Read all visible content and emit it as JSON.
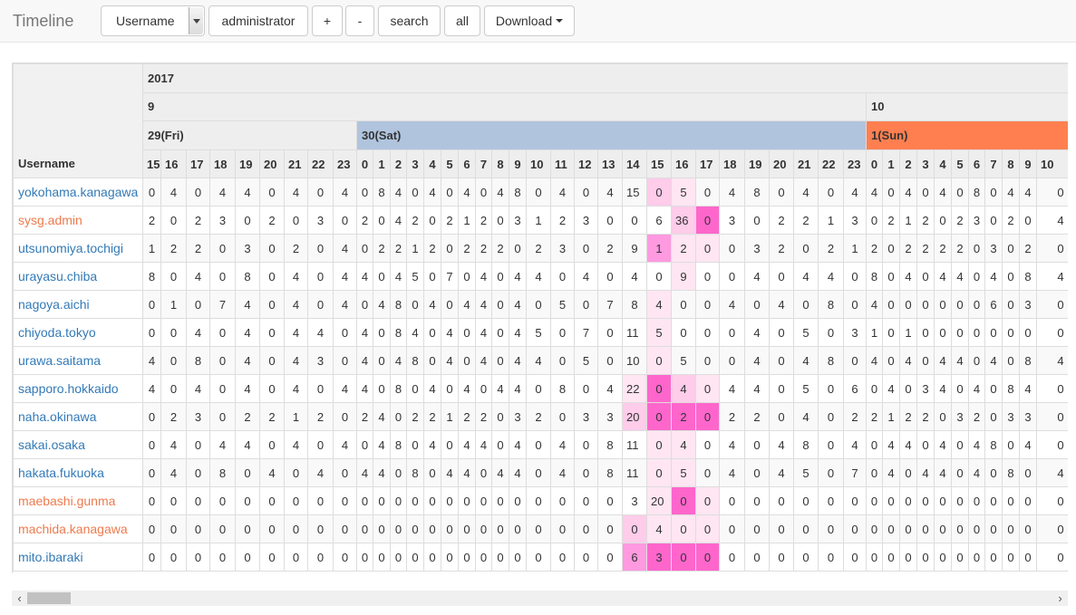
{
  "navbar": {
    "brand": "Timeline",
    "select_value": "Username",
    "query_value": "administrator",
    "plus_label": "+",
    "minus_label": "-",
    "search_label": "search",
    "all_label": "all",
    "download_label": "Download"
  },
  "table": {
    "year_label": "2017",
    "username_header": "Username",
    "months": [
      {
        "label": "9",
        "span": 33
      },
      {
        "label": "10",
        "span": 11
      }
    ],
    "days": [
      {
        "label": "29(Fri)",
        "span": 9,
        "style": "plain"
      },
      {
        "label": "30(Sat)",
        "span": 24,
        "style": "sat"
      },
      {
        "label": "1(Sun)",
        "span": 11,
        "style": "sun"
      }
    ],
    "hours": [
      15,
      16,
      17,
      18,
      19,
      20,
      21,
      22,
      23,
      0,
      1,
      2,
      3,
      4,
      5,
      6,
      7,
      8,
      9,
      10,
      11,
      12,
      13,
      14,
      15,
      16,
      17,
      18,
      19,
      20,
      21,
      22,
      23,
      0,
      1,
      2,
      3,
      4,
      5,
      6,
      7,
      8,
      9,
      10
    ],
    "rows": [
      {
        "name": "yokohama.kanagawa",
        "color": "blue",
        "values": [
          0,
          4,
          0,
          4,
          4,
          0,
          4,
          0,
          4,
          0,
          8,
          4,
          0,
          4,
          0,
          4,
          0,
          4,
          8,
          0,
          4,
          0,
          4,
          15,
          0,
          5,
          0,
          4,
          8,
          0,
          4,
          0,
          4,
          4,
          0,
          4,
          0,
          4,
          0,
          8,
          0,
          4,
          4,
          0
        ]
      },
      {
        "name": "sysg.admin",
        "color": "orange",
        "values": [
          2,
          0,
          2,
          3,
          0,
          2,
          0,
          3,
          0,
          2,
          0,
          4,
          2,
          0,
          2,
          1,
          2,
          0,
          3,
          1,
          2,
          3,
          0,
          0,
          6,
          36,
          0,
          3,
          0,
          2,
          2,
          1,
          3,
          0,
          2,
          1,
          2,
          0,
          2,
          3,
          0,
          2,
          0,
          4
        ]
      },
      {
        "name": "utsunomiya.tochigi",
        "color": "blue",
        "values": [
          1,
          2,
          2,
          0,
          3,
          0,
          2,
          0,
          4,
          0,
          2,
          2,
          1,
          2,
          0,
          2,
          2,
          2,
          0,
          2,
          3,
          0,
          2,
          9,
          1,
          2,
          0,
          0,
          3,
          2,
          0,
          2,
          1,
          2,
          0,
          2,
          2,
          2,
          2,
          0,
          3,
          0,
          2,
          0
        ]
      },
      {
        "name": "urayasu.chiba",
        "color": "blue",
        "values": [
          8,
          0,
          4,
          0,
          8,
          0,
          4,
          0,
          4,
          4,
          0,
          4,
          5,
          0,
          7,
          0,
          4,
          0,
          4,
          4,
          0,
          4,
          0,
          4,
          0,
          9,
          0,
          0,
          4,
          0,
          4,
          4,
          0,
          8,
          0,
          4,
          0,
          4,
          4,
          0,
          4,
          0,
          8,
          4
        ]
      },
      {
        "name": "nagoya.aichi",
        "color": "blue",
        "values": [
          0,
          1,
          0,
          7,
          4,
          0,
          4,
          0,
          4,
          0,
          4,
          8,
          0,
          4,
          0,
          4,
          4,
          0,
          4,
          0,
          5,
          0,
          7,
          8,
          4,
          0,
          0,
          4,
          0,
          4,
          0,
          8,
          0,
          4,
          0,
          0,
          0,
          0,
          0,
          0,
          6,
          0,
          3,
          0
        ]
      },
      {
        "name": "chiyoda.tokyo",
        "color": "blue",
        "values": [
          0,
          0,
          4,
          0,
          4,
          0,
          4,
          4,
          0,
          4,
          0,
          8,
          4,
          0,
          4,
          0,
          4,
          0,
          4,
          5,
          0,
          7,
          0,
          11,
          5,
          0,
          0,
          0,
          4,
          0,
          5,
          0,
          3,
          1,
          0,
          1,
          0,
          0,
          0,
          0,
          0,
          0,
          0,
          0
        ]
      },
      {
        "name": "urawa.saitama",
        "color": "blue",
        "values": [
          4,
          0,
          8,
          0,
          4,
          0,
          4,
          3,
          0,
          4,
          0,
          4,
          8,
          0,
          4,
          0,
          4,
          0,
          4,
          4,
          0,
          5,
          0,
          10,
          0,
          5,
          0,
          0,
          4,
          0,
          4,
          8,
          0,
          4,
          0,
          4,
          0,
          4,
          4,
          0,
          4,
          0,
          8,
          4
        ]
      },
      {
        "name": "sapporo.hokkaido",
        "color": "blue",
        "values": [
          4,
          0,
          4,
          0,
          4,
          0,
          4,
          0,
          4,
          4,
          0,
          8,
          0,
          4,
          0,
          4,
          0,
          4,
          4,
          0,
          8,
          0,
          4,
          22,
          0,
          4,
          0,
          4,
          4,
          0,
          5,
          0,
          6,
          0,
          4,
          0,
          3,
          4,
          0,
          4,
          0,
          8,
          4,
          0
        ]
      },
      {
        "name": "naha.okinawa",
        "color": "blue",
        "values": [
          0,
          2,
          3,
          0,
          2,
          2,
          1,
          2,
          0,
          2,
          4,
          0,
          2,
          2,
          1,
          2,
          2,
          0,
          3,
          2,
          0,
          3,
          3,
          20,
          0,
          2,
          0,
          2,
          2,
          0,
          4,
          0,
          2,
          2,
          1,
          2,
          2,
          0,
          3,
          2,
          0,
          3,
          3,
          0
        ]
      },
      {
        "name": "sakai.osaka",
        "color": "blue",
        "values": [
          0,
          4,
          0,
          4,
          4,
          0,
          4,
          0,
          4,
          0,
          4,
          8,
          0,
          4,
          0,
          4,
          4,
          0,
          4,
          0,
          4,
          0,
          8,
          11,
          0,
          4,
          0,
          4,
          0,
          4,
          8,
          0,
          4,
          0,
          4,
          4,
          0,
          4,
          0,
          4,
          8,
          0,
          4,
          0
        ]
      },
      {
        "name": "hakata.fukuoka",
        "color": "blue",
        "values": [
          0,
          4,
          0,
          8,
          0,
          4,
          0,
          4,
          0,
          4,
          4,
          0,
          8,
          0,
          4,
          4,
          0,
          4,
          4,
          0,
          4,
          0,
          8,
          11,
          0,
          5,
          0,
          4,
          0,
          4,
          5,
          0,
          7,
          0,
          4,
          0,
          4,
          4,
          0,
          4,
          0,
          8,
          0,
          4
        ]
      },
      {
        "name": "maebashi.gunma",
        "color": "orange",
        "values": [
          0,
          0,
          0,
          0,
          0,
          0,
          0,
          0,
          0,
          0,
          0,
          0,
          0,
          0,
          0,
          0,
          0,
          0,
          0,
          0,
          0,
          0,
          0,
          3,
          20,
          0,
          0,
          0,
          0,
          0,
          0,
          0,
          0,
          0,
          0,
          0,
          0,
          0,
          0,
          0,
          0,
          0,
          0,
          0
        ]
      },
      {
        "name": "machida.kanagawa",
        "color": "orange",
        "values": [
          0,
          0,
          0,
          0,
          0,
          0,
          0,
          0,
          0,
          0,
          0,
          0,
          0,
          0,
          0,
          0,
          0,
          0,
          0,
          0,
          0,
          0,
          0,
          0,
          4,
          0,
          0,
          0,
          0,
          0,
          0,
          0,
          0,
          0,
          0,
          0,
          0,
          0,
          0,
          0,
          0,
          0,
          0,
          0
        ]
      },
      {
        "name": "mito.ibaraki",
        "color": "blue",
        "values": [
          0,
          0,
          0,
          0,
          0,
          0,
          0,
          0,
          0,
          0,
          0,
          0,
          0,
          0,
          0,
          0,
          0,
          0,
          0,
          0,
          0,
          0,
          0,
          6,
          3,
          0,
          0,
          0,
          0,
          0,
          0,
          0,
          0,
          0,
          0,
          0,
          0,
          0,
          0,
          0,
          0,
          0,
          0,
          0
        ]
      }
    ],
    "highlights": [
      {
        "row": 0,
        "col": 24,
        "level": 2
      },
      {
        "row": 0,
        "col": 25,
        "level": 1
      },
      {
        "row": 1,
        "col": 25,
        "level": 2
      },
      {
        "row": 1,
        "col": 26,
        "level": 4
      },
      {
        "row": 2,
        "col": 24,
        "level": 3
      },
      {
        "row": 2,
        "col": 25,
        "level": 1
      },
      {
        "row": 2,
        "col": 26,
        "level": 1
      },
      {
        "row": 3,
        "col": 25,
        "level": 1
      },
      {
        "row": 4,
        "col": 24,
        "level": 1
      },
      {
        "row": 5,
        "col": 24,
        "level": 1
      },
      {
        "row": 6,
        "col": 24,
        "level": 1
      },
      {
        "row": 7,
        "col": 23,
        "level": 1
      },
      {
        "row": 7,
        "col": 24,
        "level": 4
      },
      {
        "row": 7,
        "col": 25,
        "level": 2
      },
      {
        "row": 7,
        "col": 26,
        "level": 1
      },
      {
        "row": 8,
        "col": 23,
        "level": 2
      },
      {
        "row": 8,
        "col": 24,
        "level": 4
      },
      {
        "row": 8,
        "col": 25,
        "level": 4
      },
      {
        "row": 8,
        "col": 26,
        "level": 4
      },
      {
        "row": 9,
        "col": 24,
        "level": 1
      },
      {
        "row": 9,
        "col": 25,
        "level": 1
      },
      {
        "row": 10,
        "col": 24,
        "level": 1
      },
      {
        "row": 10,
        "col": 25,
        "level": 1
      },
      {
        "row": 11,
        "col": 24,
        "level": 1
      },
      {
        "row": 11,
        "col": 25,
        "level": 4
      },
      {
        "row": 11,
        "col": 26,
        "level": 1
      },
      {
        "row": 12,
        "col": 23,
        "level": 2
      },
      {
        "row": 12,
        "col": 24,
        "level": 1
      },
      {
        "row": 12,
        "col": 25,
        "level": 1
      },
      {
        "row": 12,
        "col": 26,
        "level": 1
      },
      {
        "row": 13,
        "col": 23,
        "level": 3
      },
      {
        "row": 13,
        "col": 24,
        "level": 4
      },
      {
        "row": 13,
        "col": 25,
        "level": 4
      },
      {
        "row": 13,
        "col": 26,
        "level": 4
      }
    ]
  },
  "scrollbar": {
    "left_arrow": "‹",
    "right_arrow": "›",
    "position": 0
  }
}
